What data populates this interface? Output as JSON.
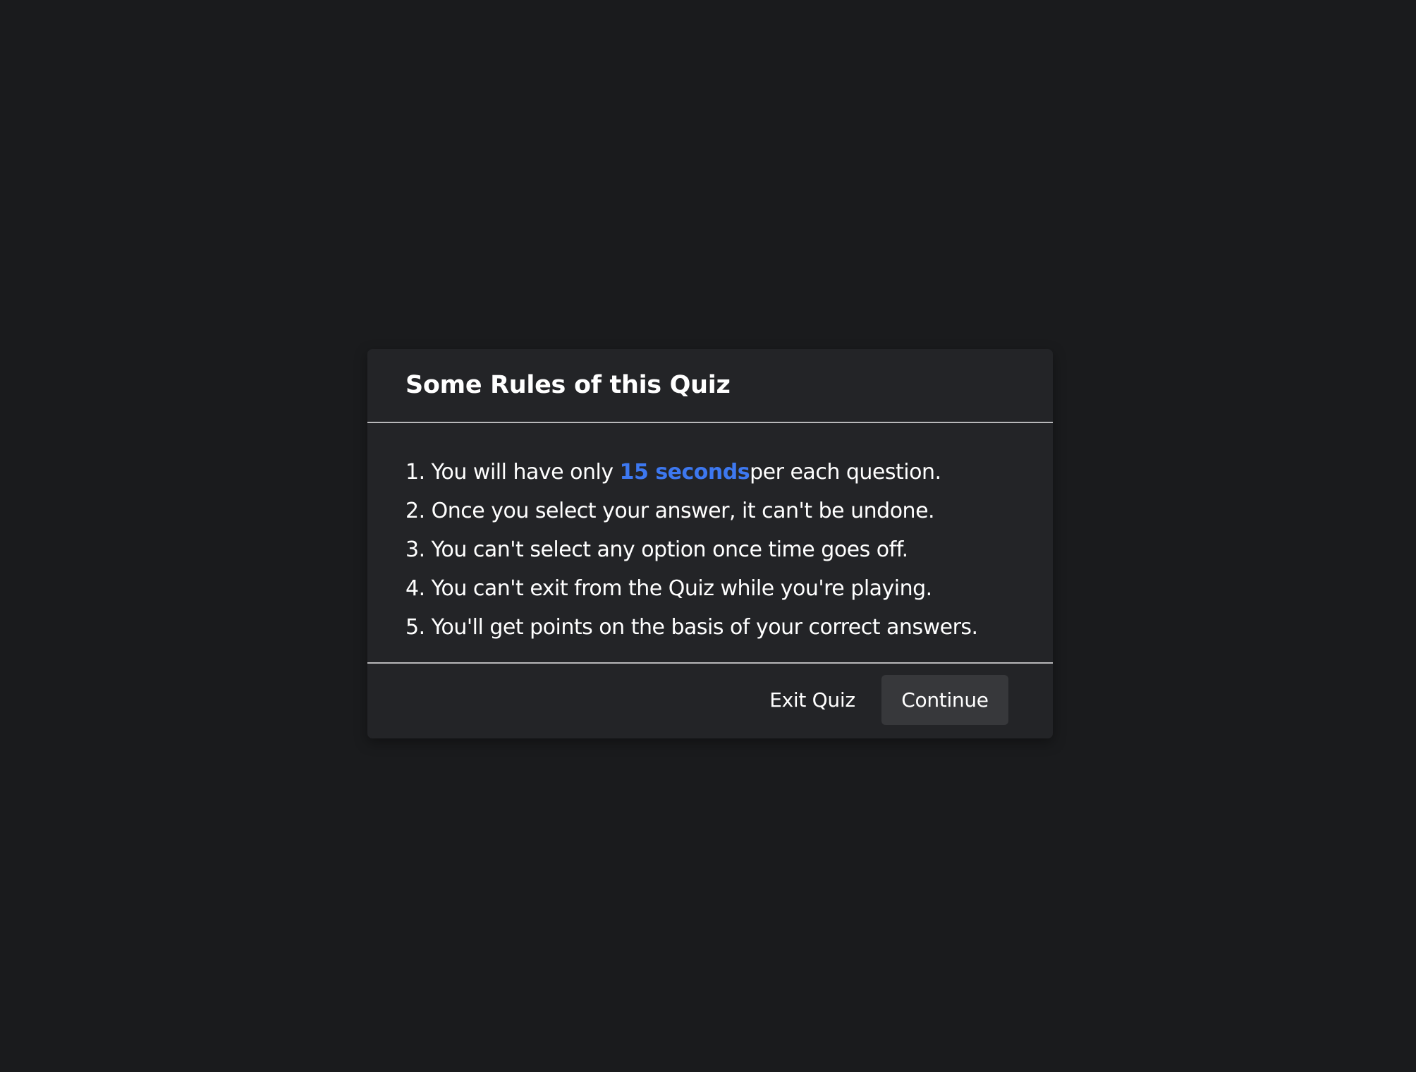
{
  "dialog": {
    "title": "Some Rules of this Quiz",
    "rules": {
      "r1_prefix": "1. You will have only ",
      "r1_highlight": "15 seconds",
      "r1_suffix": "per each question.",
      "r2": "2. Once you select your answer, it can't be undone.",
      "r3": "3. You can't select any option once time goes off.",
      "r4": "4. You can't exit from the Quiz while you're playing.",
      "r5": "5. You'll get points on the basis of your correct answers."
    },
    "buttons": {
      "exit_label": "Exit Quiz",
      "continue_label": "Continue"
    }
  },
  "colors": {
    "background": "#1a1b1d",
    "dialog_background": "#232427",
    "highlight": "#3d78f0",
    "continue_button": "#37383b"
  }
}
